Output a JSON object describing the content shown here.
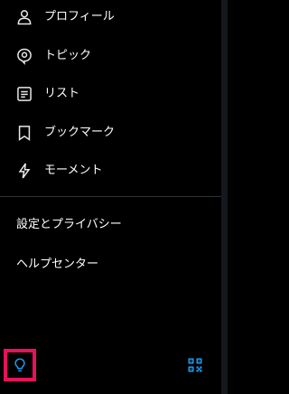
{
  "menu": {
    "items": [
      {
        "label": "プロフィール",
        "icon": "person-icon"
      },
      {
        "label": "トピック",
        "icon": "topic-icon"
      },
      {
        "label": "リスト",
        "icon": "list-icon"
      },
      {
        "label": "ブックマーク",
        "icon": "bookmark-icon"
      },
      {
        "label": "モーメント",
        "icon": "lightning-icon"
      }
    ]
  },
  "links": {
    "settings": "設定とプライバシー",
    "help": "ヘルプセンター"
  },
  "footer": {
    "left_icon": "lightbulb-icon",
    "right_icon": "qr-code-icon"
  },
  "colors": {
    "background": "#000000",
    "text": "#ffffff",
    "accent": "#1d9bf0",
    "highlight": "#e8115b",
    "divider": "#2f3336"
  }
}
